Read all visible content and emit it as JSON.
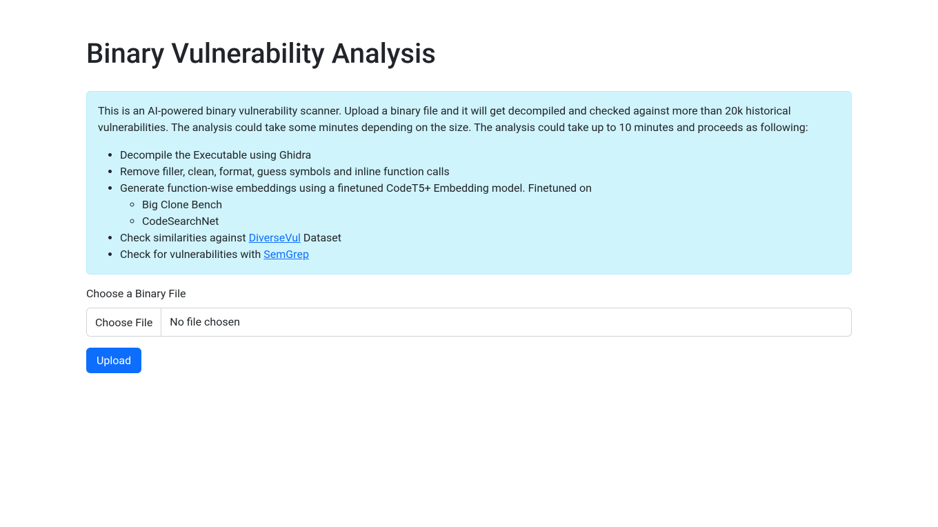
{
  "page": {
    "title": "Binary Vulnerability Analysis"
  },
  "info": {
    "intro": "This is an AI-powered binary vulnerability scanner. Upload a binary file and it will get decompiled and checked against more than 20k historical vulnerabilities. The analysis could take some minutes depending on the size. The analysis could take up to 10 minutes and proceeds as following:",
    "steps": [
      "Decompile the Executable using Ghidra",
      "Remove filler, clean, format, guess symbols and inline function calls",
      "Generate function-wise embeddings using a finetuned CodeT5+ Embedding model. Finetuned on"
    ],
    "sub_steps": [
      "Big Clone Bench",
      "CodeSearchNet"
    ],
    "step_check1_prefix": "Check similarities against ",
    "step_check1_link": "DiverseVul",
    "step_check1_suffix": " Dataset",
    "step_check2_prefix": "Check for vulnerabilities with ",
    "step_check2_link": "SemGrep"
  },
  "form": {
    "file_label": "Choose a Binary File",
    "choose_button": "Choose File",
    "file_status": "No file chosen",
    "upload_button": "Upload"
  }
}
